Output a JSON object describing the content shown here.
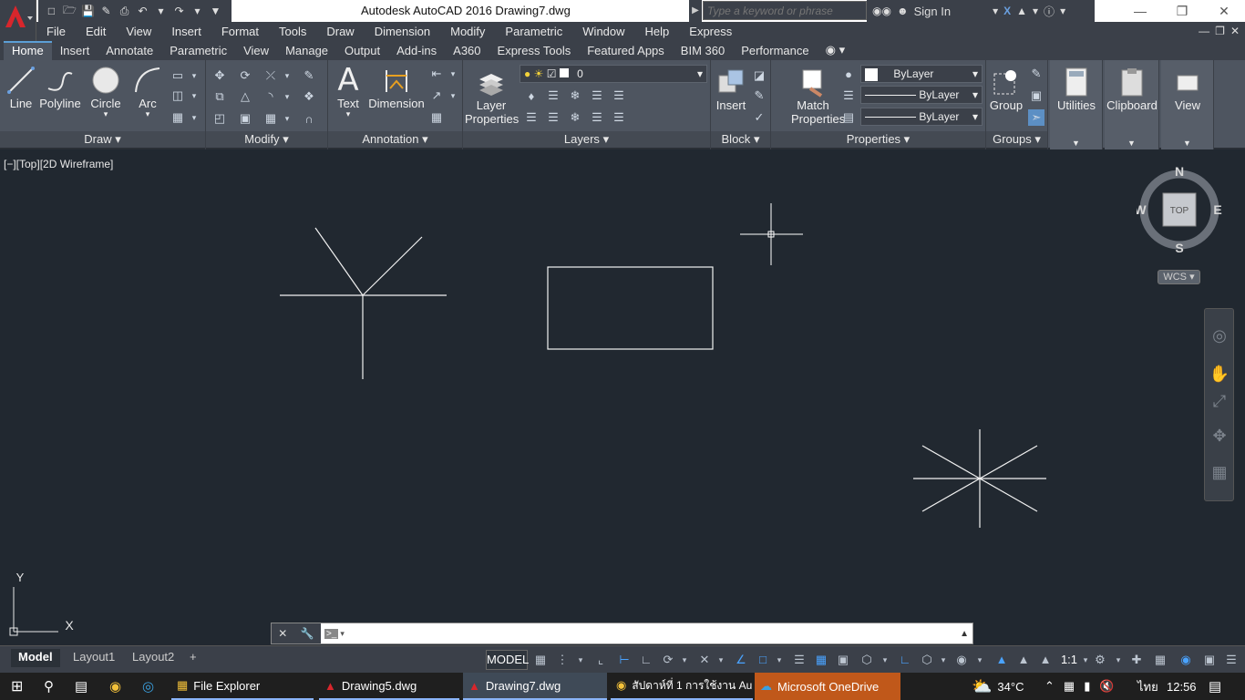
{
  "window": {
    "title": "Autodesk AutoCAD 2016    Drawing7.dwg"
  },
  "search": {
    "placeholder": "Type a keyword or phrase"
  },
  "account": {
    "sign_in": "Sign In"
  },
  "menu": [
    "File",
    "Edit",
    "View",
    "Insert",
    "Format",
    "Tools",
    "Draw",
    "Dimension",
    "Modify",
    "Parametric",
    "Window",
    "Help",
    "Express"
  ],
  "ribbon_tabs": [
    "Home",
    "Insert",
    "Annotate",
    "Parametric",
    "View",
    "Manage",
    "Output",
    "Add-ins",
    "A360",
    "Express Tools",
    "Featured Apps",
    "BIM 360",
    "Performance"
  ],
  "active_tab": "Home",
  "draw_panel": {
    "title": "Draw",
    "line": "Line",
    "polyline": "Polyline",
    "circle": "Circle",
    "arc": "Arc"
  },
  "modify_panel": {
    "title": "Modify"
  },
  "annotation_panel": {
    "title": "Annotation",
    "text": "Text",
    "dimension": "Dimension"
  },
  "layers_panel": {
    "title": "Layers",
    "layer_properties_1": "Layer",
    "layer_properties_2": "Properties",
    "current_layer": "0"
  },
  "block_panel": {
    "title": "Block",
    "insert": "Insert"
  },
  "properties_panel": {
    "title": "Properties",
    "match_1": "Match",
    "match_2": "Properties",
    "color": "ByLayer",
    "linetype": "ByLayer",
    "lineweight": "ByLayer"
  },
  "groups_panel": {
    "title": "Groups",
    "group": "Group"
  },
  "utilities": "Utilities",
  "clipboard": "Clipboard",
  "view_panel": "View",
  "viewport_label": "[−][Top][2D Wireframe]",
  "viewcube": {
    "n": "N",
    "s": "S",
    "e": "E",
    "w": "W",
    "face": "TOP",
    "wcs": "WCS"
  },
  "ucs": {
    "x": "X",
    "y": "Y"
  },
  "layouts": [
    "Model",
    "Layout1",
    "Layout2"
  ],
  "status": {
    "model": "MODEL",
    "scale": "1:1"
  },
  "taskbar": {
    "items": [
      "File Explorer",
      "Drawing5.dwg",
      "Drawing7.dwg",
      "สัปดาห์ที่ 1 การใช้งาน Au...",
      "Microsoft OneDrive"
    ],
    "temperature": "34°C",
    "language": "ไทย",
    "time": "12:56"
  }
}
